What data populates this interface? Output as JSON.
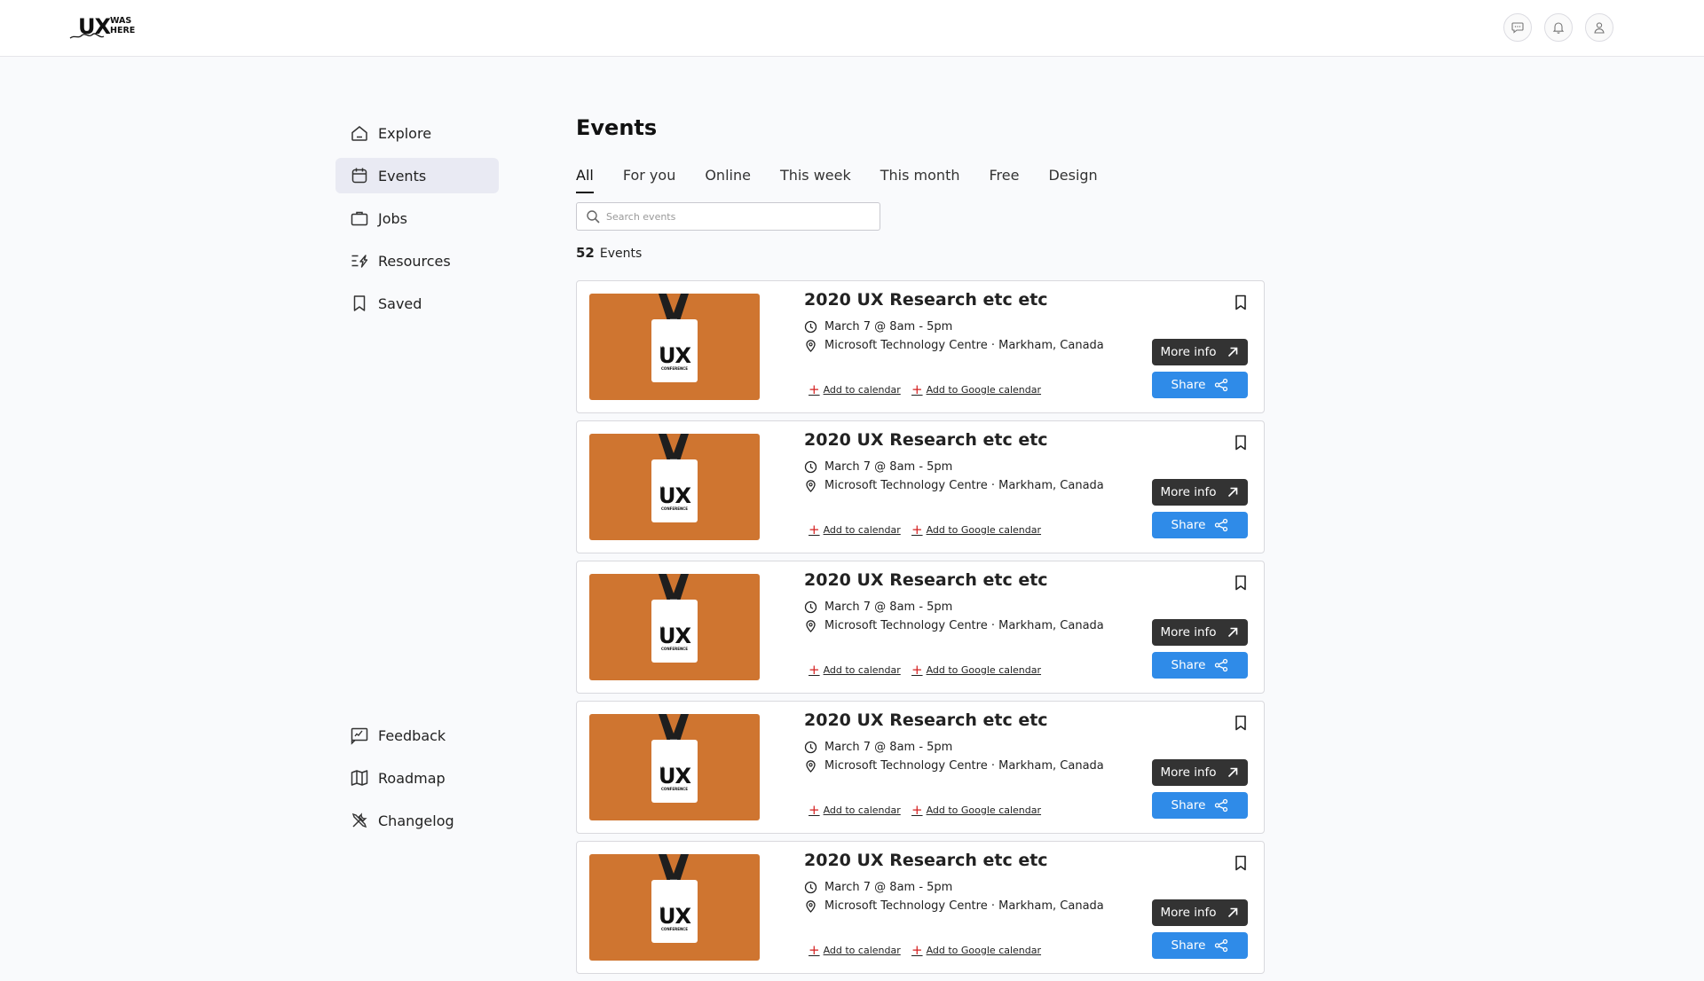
{
  "header": {
    "logo": {
      "ux": "UX",
      "was": "WAS",
      "here": "HERE"
    },
    "icons": [
      "chat-icon",
      "bell-icon",
      "user-icon"
    ]
  },
  "sidebar": {
    "items": [
      {
        "label": "Explore",
        "icon": "home-icon"
      },
      {
        "label": "Events",
        "icon": "calendar-icon",
        "active": true
      },
      {
        "label": "Jobs",
        "icon": "briefcase-icon"
      },
      {
        "label": "Resources",
        "icon": "resources-icon"
      },
      {
        "label": "Saved",
        "icon": "bookmark-icon"
      }
    ],
    "bottom_items": [
      {
        "label": "Feedback",
        "icon": "feedback-icon"
      },
      {
        "label": "Roadmap",
        "icon": "map-icon"
      },
      {
        "label": "Changelog",
        "icon": "tools-icon"
      }
    ]
  },
  "main": {
    "title": "Events",
    "tabs": [
      "All",
      "For you",
      "Online",
      "This week",
      "This month",
      "Free",
      "Design"
    ],
    "active_tab": "All",
    "search": {
      "placeholder": "Search events",
      "value": ""
    },
    "count": {
      "number": "52",
      "label": "Events"
    },
    "events": [
      {
        "title": "2020 UX Research etc etc",
        "time": "March 7 @ 8am - 5pm",
        "location": "Microsoft Technology Centre · Markham, Canada",
        "add_calendar": "Add to calendar",
        "add_google": "Add to Google calendar",
        "more": "More info",
        "share": "Share",
        "image_text": {
          "the": "THE",
          "ux": "UX",
          "conference": "CONFERENCE"
        }
      },
      {
        "title": "2020 UX Research etc etc",
        "time": "March 7 @ 8am - 5pm",
        "location": "Microsoft Technology Centre · Markham, Canada",
        "add_calendar": "Add to calendar",
        "add_google": "Add to Google calendar",
        "more": "More info",
        "share": "Share",
        "image_text": {
          "the": "THE",
          "ux": "UX",
          "conference": "CONFERENCE"
        }
      },
      {
        "title": "2020 UX Research etc etc",
        "time": "March 7 @ 8am - 5pm",
        "location": "Microsoft Technology Centre · Markham, Canada",
        "add_calendar": "Add to calendar",
        "add_google": "Add to Google calendar",
        "more": "More info",
        "share": "Share",
        "image_text": {
          "the": "THE",
          "ux": "UX",
          "conference": "CONFERENCE"
        }
      },
      {
        "title": "2020 UX Research etc etc",
        "time": "March 7 @ 8am - 5pm",
        "location": "Microsoft Technology Centre · Markham, Canada",
        "add_calendar": "Add to calendar",
        "add_google": "Add to Google calendar",
        "more": "More info",
        "share": "Share",
        "image_text": {
          "the": "THE",
          "ux": "UX",
          "conference": "CONFERENCE"
        }
      },
      {
        "title": "2020 UX Research etc etc",
        "time": "March 7 @ 8am - 5pm",
        "location": "Microsoft Technology Centre · Markham, Canada",
        "add_calendar": "Add to calendar",
        "add_google": "Add to Google calendar",
        "more": "More info",
        "share": "Share",
        "image_text": {
          "the": "THE",
          "ux": "UX",
          "conference": "CONFERENCE"
        }
      }
    ]
  },
  "colors": {
    "accent_blue": "#2f8be8",
    "dark_button": "#333333",
    "thumb_orange": "#cf7530",
    "plus_red": "#d41f1f",
    "active_nav_bg": "#e9eaf3"
  }
}
